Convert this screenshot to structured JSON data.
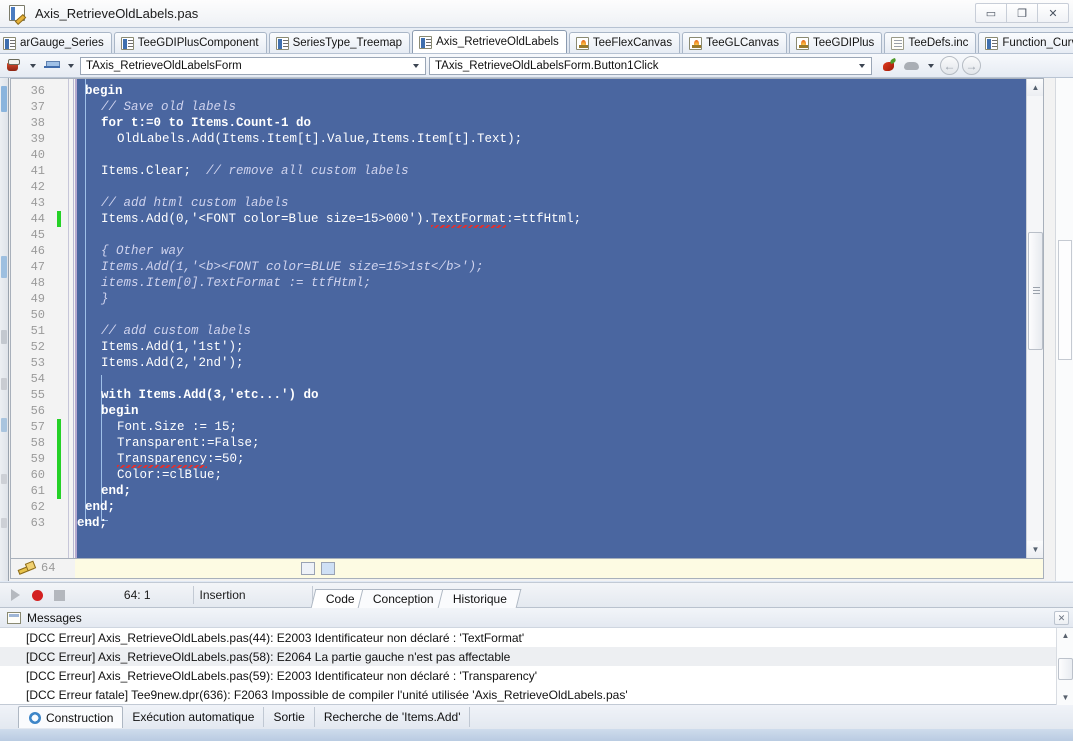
{
  "window": {
    "title": "Axis_RetrieveOldLabels.pas",
    "icon": "document-edit-icon",
    "controls": [
      {
        "name": "minimize",
        "glyph": "▭"
      },
      {
        "name": "restore",
        "glyph": "❐"
      },
      {
        "name": "close",
        "glyph": "✕"
      }
    ]
  },
  "file_tabs": [
    {
      "label": "arGauge_Series",
      "icon": "pas-unit-icon",
      "active": false,
      "clipped": true
    },
    {
      "label": "TeeGDIPlusComponent",
      "icon": "pas-unit-icon",
      "active": false
    },
    {
      "label": "SeriesType_Treemap",
      "icon": "pas-unit-icon",
      "active": false
    },
    {
      "label": "Axis_RetrieveOldLabels",
      "icon": "pas-unit-icon",
      "active": true
    },
    {
      "label": "TeeFlexCanvas",
      "icon": "fire-project-icon",
      "active": false
    },
    {
      "label": "TeeGLCanvas",
      "icon": "fire-project-icon",
      "active": false
    },
    {
      "label": "TeeGDIPlus",
      "icon": "fire-project-icon",
      "active": false
    },
    {
      "label": "TeeDefs.inc",
      "icon": "include-file-icon",
      "active": false
    },
    {
      "label": "Function_CurveFitting",
      "icon": "pas-unit-icon",
      "active": false
    }
  ],
  "tab_nav": [
    {
      "name": "tab-scroll-left",
      "glyph": "◁"
    },
    {
      "name": "tab-scroll-right",
      "glyph": "▷"
    },
    {
      "name": "tab-favorite",
      "glyph": "♡"
    },
    {
      "name": "tab-close",
      "glyph": "✕"
    }
  ],
  "toolbar": {
    "coffee_icon": "coffee-cup-icon",
    "print_icon": "print-icon",
    "class_combo_value": "TAxis_RetrieveOldLabelsForm",
    "member_combo_value": "TAxis_RetrieveOldLabelsForm.Button1Click",
    "pepper_icon": "pepper-icon",
    "cloud_icon": "cloud-icon",
    "back_glyph": "←",
    "forward_glyph": "→"
  },
  "editor": {
    "first_line": 36,
    "current_line_label": "64",
    "lines": [
      {
        "n": 36,
        "indent": 0,
        "change": "none",
        "segs": [
          {
            "t": "begin",
            "c": "kw"
          }
        ]
      },
      {
        "n": 37,
        "indent": 2,
        "change": "none",
        "segs": [
          {
            "t": "// Save old labels",
            "c": "cm"
          }
        ]
      },
      {
        "n": 38,
        "indent": 2,
        "change": "none",
        "segs": [
          {
            "t": "for t:=0 to Items.Count-1 do",
            "c": "kw"
          }
        ]
      },
      {
        "n": 39,
        "indent": 4,
        "change": "none",
        "segs": [
          {
            "t": "OldLabels.Add(Items.Item[t].Value,Items.Item[t].Text);",
            "c": "tx"
          }
        ]
      },
      {
        "n": 40,
        "indent": 0,
        "change": "none",
        "segs": []
      },
      {
        "n": 41,
        "indent": 2,
        "change": "none",
        "segs": [
          {
            "t": "Items.Clear;  ",
            "c": "tx"
          },
          {
            "t": "// remove all custom labels",
            "c": "cm"
          }
        ]
      },
      {
        "n": 42,
        "indent": 0,
        "change": "none",
        "segs": []
      },
      {
        "n": 43,
        "indent": 2,
        "change": "none",
        "segs": [
          {
            "t": "// add html custom labels",
            "c": "cm"
          }
        ]
      },
      {
        "n": 44,
        "indent": 2,
        "change": "green",
        "segs": [
          {
            "t": "Items.Add(0,'<FONT color=Blue size=15>000').",
            "c": "tx"
          },
          {
            "t": "TextFormat",
            "c": "err"
          },
          {
            "t": ":=ttfHtml;",
            "c": "tx"
          }
        ]
      },
      {
        "n": 45,
        "indent": 0,
        "change": "none",
        "segs": []
      },
      {
        "n": 46,
        "indent": 2,
        "change": "none",
        "segs": [
          {
            "t": "{ Other way",
            "c": "cm"
          }
        ]
      },
      {
        "n": 47,
        "indent": 2,
        "change": "none",
        "segs": [
          {
            "t": "Items.Add(1,'<b><FONT color=BLUE size=15>1st</b>');",
            "c": "cm"
          }
        ]
      },
      {
        "n": 48,
        "indent": 2,
        "change": "none",
        "segs": [
          {
            "t": "items.Item[0].TextFormat := ttfHtml;",
            "c": "cm"
          }
        ]
      },
      {
        "n": 49,
        "indent": 2,
        "change": "none",
        "segs": [
          {
            "t": "}",
            "c": "cm"
          }
        ]
      },
      {
        "n": 50,
        "indent": 0,
        "change": "none",
        "segs": []
      },
      {
        "n": 51,
        "indent": 2,
        "change": "none",
        "segs": [
          {
            "t": "// add custom labels",
            "c": "cm"
          }
        ]
      },
      {
        "n": 52,
        "indent": 2,
        "change": "none",
        "segs": [
          {
            "t": "Items.Add(1,'1st');",
            "c": "tx"
          }
        ]
      },
      {
        "n": 53,
        "indent": 2,
        "change": "none",
        "segs": [
          {
            "t": "Items.Add(2,'2nd');",
            "c": "tx"
          }
        ]
      },
      {
        "n": 54,
        "indent": 0,
        "change": "none",
        "segs": []
      },
      {
        "n": 55,
        "indent": 2,
        "change": "none",
        "segs": [
          {
            "t": "with Items.Add(3,'etc...') do",
            "c": "kw"
          }
        ]
      },
      {
        "n": 56,
        "indent": 2,
        "change": "none",
        "segs": [
          {
            "t": "begin",
            "c": "kw"
          }
        ]
      },
      {
        "n": 57,
        "indent": 4,
        "change": "green",
        "segs": [
          {
            "t": "Font.Size := 15;",
            "c": "tx"
          }
        ]
      },
      {
        "n": 58,
        "indent": 4,
        "change": "green",
        "segs": [
          {
            "t": "Transparent:=False;",
            "c": "tx"
          }
        ]
      },
      {
        "n": 59,
        "indent": 4,
        "change": "green",
        "segs": [
          {
            "t": "Transparency",
            "c": "err"
          },
          {
            "t": ":=50;",
            "c": "tx"
          }
        ]
      },
      {
        "n": 60,
        "indent": 4,
        "change": "green",
        "segs": [
          {
            "t": "Color:=clBlue;",
            "c": "tx"
          }
        ]
      },
      {
        "n": 61,
        "indent": 2,
        "change": "green",
        "segs": [
          {
            "t": "end;",
            "c": "kw"
          }
        ]
      },
      {
        "n": 62,
        "indent": 0,
        "change": "none",
        "segs": [
          {
            "t": "end;",
            "c": "kw"
          }
        ]
      },
      {
        "n": 63,
        "indent": -1,
        "change": "none",
        "segs": [
          {
            "t": "end;",
            "c": "kw"
          }
        ]
      }
    ]
  },
  "status_bar": {
    "cursor_position": "64:  1",
    "insert_mode": "Insertion",
    "view_tabs": [
      {
        "label": "Code",
        "active": true
      },
      {
        "label": "Conception",
        "active": false
      },
      {
        "label": "Historique",
        "active": false
      }
    ]
  },
  "messages": {
    "title": "Messages",
    "close_glyph": "✕",
    "rows": [
      {
        "text": "[DCC Erreur] Axis_RetrieveOldLabels.pas(44): E2003 Identificateur non déclaré : 'TextFormat'",
        "selected": false
      },
      {
        "text": "[DCC Erreur] Axis_RetrieveOldLabels.pas(58): E2064 La partie gauche n'est pas affectable",
        "selected": true
      },
      {
        "text": "[DCC Erreur] Axis_RetrieveOldLabels.pas(59): E2003 Identificateur non déclaré : 'Transparency'",
        "selected": false
      },
      {
        "text": "[DCC Erreur fatale] Tee9new.dpr(636): F2063 Impossible de compiler l'unité utilisée 'Axis_RetrieveOldLabels.pas'",
        "selected": false
      }
    ]
  },
  "bottom_tabs": [
    {
      "label": "Construction",
      "icon": "gear-icon",
      "active": true
    },
    {
      "label": "Exécution automatique",
      "icon": "",
      "active": false
    },
    {
      "label": "Sortie",
      "icon": "",
      "active": false
    },
    {
      "label": "Recherche de 'Items.Add'",
      "icon": "",
      "active": false
    }
  ],
  "colors": {
    "code_background": "#4a66a0",
    "code_text": "#ffffff",
    "comment": "#cfd3ee",
    "change_marker": "#25d127",
    "error_squiggle": "#e03030",
    "current_line": "#fdfbe3"
  }
}
